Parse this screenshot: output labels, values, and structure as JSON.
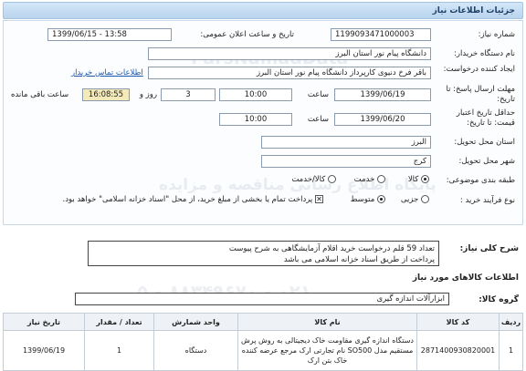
{
  "header": {
    "title": "جزئیات اطلاعات نیاز"
  },
  "fields": {
    "need_number_label": "شماره نیاز:",
    "need_number": "1199093471000003",
    "announce_label": "تاریخ و ساعت اعلان عمومی:",
    "announce_value": "1399/06/15 - 13:58",
    "buyer_label": "نام دستگاه خریدار:",
    "buyer_value": "دانشگاه پیام نور استان البرز",
    "creator_label": "ایجاد کننده درخواست:",
    "creator_value": "باقر فرخ دنیوی کارپرداز دانشگاه پیام نور استان البرز",
    "contact_link": "اطلاعات تماس خریدار",
    "reply_label": "مهلت ارسال پاسخ: تا تاریخ:",
    "reply_date": "1399/06/19",
    "time_label": "ساعت",
    "reply_time": "10:00",
    "days_value": "3",
    "day_and_label": "روز و",
    "remaining_time": "16:08:55",
    "remaining_label": "ساعت باقی مانده",
    "validity_label": "حداقل تاریخ اعتبار قیمت: تا تاریخ:",
    "validity_date": "1399/06/20",
    "validity_time": "10:00",
    "province_label": "استان محل تحویل:",
    "province_value": "البرز",
    "city_label": "شهر محل تحویل:",
    "city_value": "کرج",
    "category_label": "طبقه بندی موضوعی:",
    "category_options": [
      "کالا",
      "خدمت",
      "کالا/خدمت"
    ],
    "process_label": "نوع فرآیند خرید :",
    "process_options": [
      "جزیی",
      "متوسط"
    ],
    "payment_note": "پرداخت تمام یا بخشی از مبلغ خرید، از محل \"اسناد خزانه اسلامی\" خواهد بود."
  },
  "watermarks": [
    "ParsNamadData",
    "پایگاه اطلاع رسانی مناقصه و مزایده",
    "۰۲۱ - ۸۸۳۴۹۶۷۰ - ۵"
  ],
  "description": {
    "label": "شرح کلی نیاز:",
    "line1": "تعداد 59 قلم درخواست خرید اقلام آزمایشگاهی به شرح پیوست",
    "line2": "پرداخت از طریق اسناد خزانه اسلامی می باشد"
  },
  "goods": {
    "section_title": "اطلاعات کالاهای مورد نیاز",
    "group_label": "گروه کالا:",
    "group_value": "ابزارآلات اندازه گیری",
    "columns": [
      "ردیف",
      "کد کالا",
      "نام کالا",
      "واحد شمارش",
      "تعداد / مقدار",
      "تاریخ نیاز"
    ],
    "rows": [
      {
        "index": "1",
        "code": "2871400930820001",
        "name": "دستگاه اندازه گیری مقاومت خاک دیجیتالی به روش پرش مستقیم مدل SO500 نام تجارتی ارک مرجع عرضه کننده خاک بتن ارک",
        "unit": "دستگاه",
        "qty": "1",
        "date": "1399/06/19"
      }
    ]
  }
}
